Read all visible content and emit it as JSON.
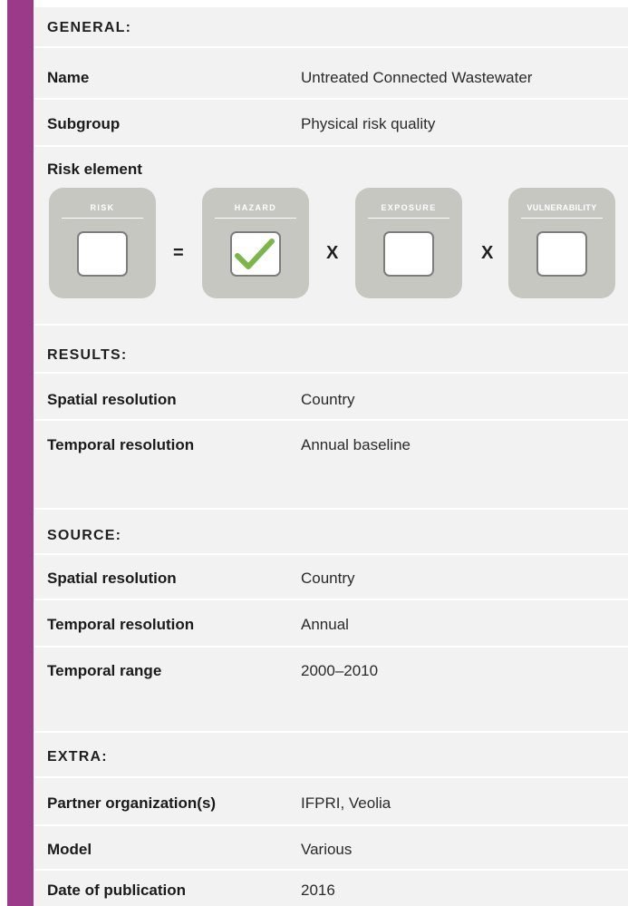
{
  "general": {
    "title": "GENERAL:",
    "rows": [
      {
        "label": "Name",
        "value": "Untreated Connected Wastewater"
      },
      {
        "label": "Subgroup",
        "value": "Physical risk quality"
      }
    ],
    "risk_element_label": "Risk element"
  },
  "risk_equation": {
    "cards": [
      {
        "caption": "RISK",
        "checked": false
      },
      {
        "caption": "HAZARD",
        "checked": true
      },
      {
        "caption": "EXPOSURE",
        "checked": false
      },
      {
        "caption": "VULNERABILITY",
        "checked": false
      }
    ],
    "operators": [
      "=",
      "X",
      "X"
    ]
  },
  "results": {
    "title": "RESULTS:",
    "rows": [
      {
        "label": "Spatial resolution",
        "value": "Country"
      },
      {
        "label": "Temporal resolution",
        "value": "Annual baseline"
      }
    ]
  },
  "source": {
    "title": "SOURCE:",
    "rows": [
      {
        "label": "Spatial resolution",
        "value": "Country"
      },
      {
        "label": "Temporal resolution",
        "value": "Annual"
      },
      {
        "label": "Temporal range",
        "value": "2000–2010"
      }
    ]
  },
  "extra": {
    "title": "EXTRA:",
    "rows": [
      {
        "label": "Partner organization(s)",
        "value": "IFPRI, Veolia"
      },
      {
        "label": "Model",
        "value": "Various"
      },
      {
        "label": "Date of publication",
        "value": "2016"
      }
    ]
  },
  "colors": {
    "sidebar": "#9c3a8a",
    "panel": "#f2f2f2",
    "card": "#c7c7c2",
    "checkmark": "#7ab648"
  }
}
